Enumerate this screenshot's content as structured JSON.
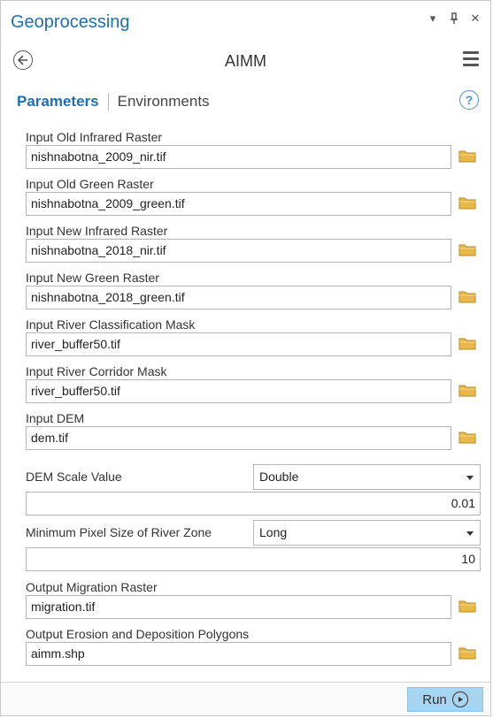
{
  "pane": {
    "title": "Geoprocessing",
    "controls": {
      "dropdown": "▾",
      "pin": "⊥",
      "close": "✕"
    }
  },
  "tool": {
    "name": "AIMM"
  },
  "tabs": {
    "active": "Parameters",
    "inactive": "Environments",
    "help": "?"
  },
  "params": [
    {
      "label": "Input Old Infrared Raster",
      "value": "nishnabotna_2009_nir.tif"
    },
    {
      "label": "Input Old Green Raster",
      "value": "nishnabotna_2009_green.tif"
    },
    {
      "label": "Input New Infrared Raster",
      "value": "nishnabotna_2018_nir.tif"
    },
    {
      "label": "Input New Green Raster",
      "value": "nishnabotna_2018_green.tif"
    },
    {
      "label": "Input River Classification Mask",
      "value": "river_buffer50.tif"
    },
    {
      "label": "Input River Corridor Mask",
      "value": "river_buffer50.tif"
    },
    {
      "label": "Input DEM",
      "value": "dem.tif"
    }
  ],
  "dem_scale": {
    "label": "DEM Scale Value",
    "type": "Double",
    "value": "0.01"
  },
  "min_pixel": {
    "label": "Minimum Pixel Size of River Zone",
    "type": "Long",
    "value": "10"
  },
  "outputs": [
    {
      "label": "Output Migration Raster",
      "value": "migration.tif"
    },
    {
      "label": "Output Erosion and Deposition Polygons",
      "value": "aimm.shp"
    }
  ],
  "footer": {
    "run_label": "Run"
  },
  "colors": {
    "accent": "#1d6fb2",
    "folder": "#e8b84a",
    "run_bg": "#a9d4f0"
  },
  "icons": [
    "back-arrow-icon",
    "menu-icon",
    "help-icon",
    "folder-icon",
    "dropdown-caret-icon",
    "run-play-icon"
  ]
}
